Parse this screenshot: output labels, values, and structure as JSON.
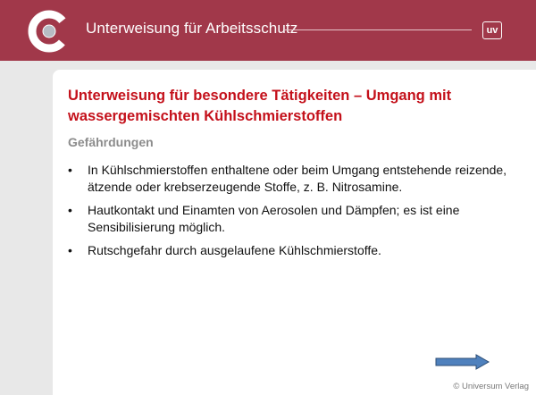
{
  "header": {
    "title": "Unterweisung für Arbeitsschutz",
    "badge": "uv",
    "color": "#a1384a"
  },
  "slide": {
    "title": "Unterweisung für besondere Tätigkeiten – Umgang mit wassergemischten Kühlschmierstoffen",
    "subtitle": "Gefährdungen",
    "bullets": [
      "In Kühlschmierstoffen enthaltene oder beim Umgang entstehende reizende, ätzende oder krebserzeugende Stoffe, z. B. Nitrosamine.",
      "Hautkontakt und Einamten von Aerosolen und Dämpfen; es ist eine Sensibilisierung möglich.",
      "Rutschgefahr durch ausgelaufene Kühlschmierstoffe."
    ],
    "bullet_symbol": "•",
    "title_color": "#c4111b"
  },
  "footer": {
    "copyright": "© Universum Verlag",
    "next_icon": "arrow-right-icon"
  }
}
